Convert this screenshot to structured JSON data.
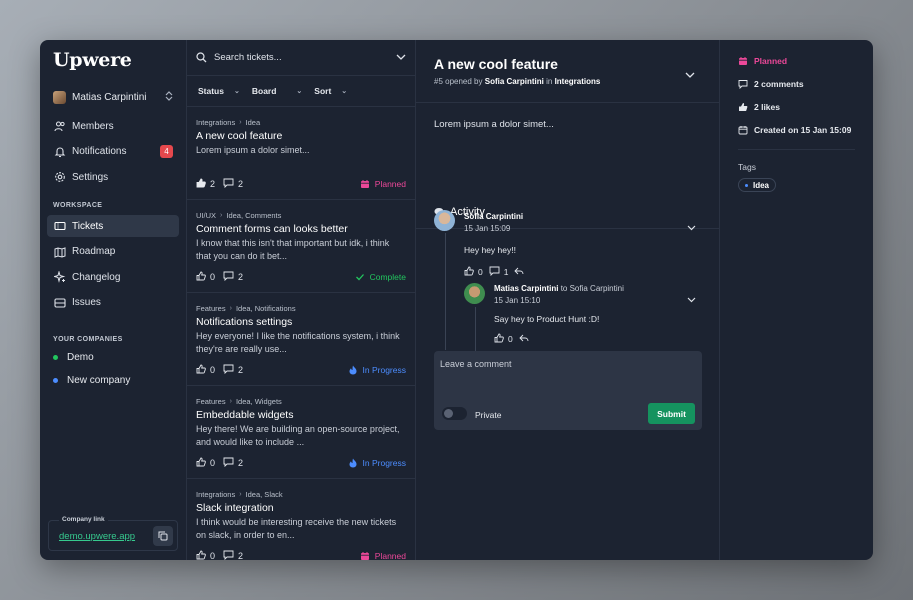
{
  "app": {
    "logo": "Upwere"
  },
  "colors": {
    "accent_green": "#15935f",
    "planned": "#ec4899",
    "complete": "#22c55e",
    "in_progress": "#4c8dff",
    "badge": "#e5484d"
  },
  "sidebar": {
    "user": "Matias Carpintini",
    "nav": [
      {
        "label": "Members",
        "icon": "users-icon"
      },
      {
        "label": "Notifications",
        "icon": "bell-icon",
        "badge": "4"
      },
      {
        "label": "Settings",
        "icon": "gear-icon"
      }
    ],
    "workspace_label": "WORKSPACE",
    "workspace": [
      {
        "label": "Tickets",
        "icon": "ticket-icon",
        "active": true
      },
      {
        "label": "Roadmap",
        "icon": "map-icon"
      },
      {
        "label": "Changelog",
        "icon": "sparkle-icon"
      },
      {
        "label": "Issues",
        "icon": "issues-icon"
      }
    ],
    "companies_label": "YOUR COMPANIES",
    "companies": [
      {
        "label": "Demo",
        "color": "#22c55e"
      },
      {
        "label": "New company",
        "color": "#4c8dff"
      }
    ],
    "company_link": {
      "label": "Company link",
      "url": "demo.upwere.app"
    }
  },
  "list": {
    "search_placeholder": "Search tickets...",
    "filters": [
      "Status",
      "Board",
      "Sort"
    ],
    "tickets": [
      {
        "board": "Integrations",
        "tags": "Idea",
        "title": "A new cool feature",
        "desc": "Lorem ipsum a dolor simet...",
        "likes": "2",
        "comments": "2",
        "status": "Planned"
      },
      {
        "board": "UI/UX",
        "tags": "Idea, Comments",
        "title": "Comment forms can looks better",
        "desc": "I know that this isn't that important but idk, i think that you can do it bet...",
        "likes": "0",
        "comments": "2",
        "status": "Complete"
      },
      {
        "board": "Features",
        "tags": "Idea, Notifications",
        "title": "Notifications settings",
        "desc": "Hey everyone! I like the notifications system, i think they're are really use...",
        "likes": "0",
        "comments": "2",
        "status": "In Progress"
      },
      {
        "board": "Features",
        "tags": "Idea, Widgets",
        "title": "Embeddable widgets",
        "desc": "Hey there! We are building an open-source project, and would like to include ...",
        "likes": "0",
        "comments": "2",
        "status": "In Progress"
      },
      {
        "board": "Integrations",
        "tags": "Idea, Slack",
        "title": "Slack integration",
        "desc": "I think would be interesting receive the new tickets on slack, in order to en...",
        "likes": "0",
        "comments": "2",
        "status": "Planned"
      }
    ]
  },
  "detail": {
    "title": "A new cool feature",
    "number": "#5 opened by",
    "author": "Sofia Carpintini",
    "in_word": "in",
    "board": "Integrations",
    "body": "Lorem ipsum a dolor simet...",
    "activity_label": "Activity",
    "comments": [
      {
        "name": "Sofia Carpintini",
        "date": "15 Jan 15:09",
        "text": "Hey hey hey!!",
        "likes": "0",
        "replies": "1"
      },
      {
        "name": "Matias Carpintini",
        "to_word": "to",
        "to": "Sofia Carpintini",
        "date": "15 Jan 15:10",
        "text": "Say hey to Product Hunt :D!",
        "likes": "0"
      }
    ],
    "compose": {
      "placeholder": "Leave a comment",
      "private_label": "Private",
      "submit_label": "Submit"
    }
  },
  "meta": {
    "status": "Planned",
    "comments": "2 comments",
    "likes": "2 likes",
    "created": "Created on 15 Jan 15:09",
    "tags_label": "Tags",
    "tags": [
      "Idea"
    ]
  }
}
